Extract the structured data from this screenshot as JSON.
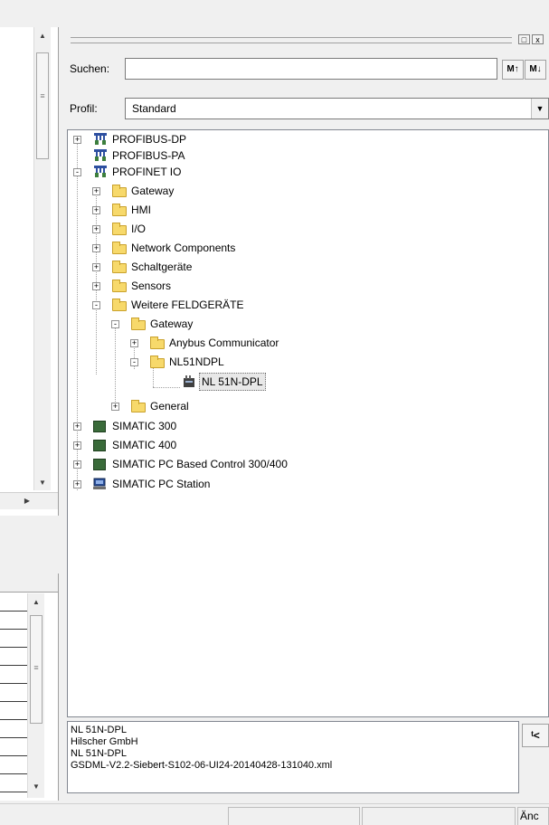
{
  "search": {
    "label": "Suchen:",
    "value": "",
    "find_up": "M↑",
    "find_down": "M↓"
  },
  "profile": {
    "label": "Profil:",
    "value": "Standard"
  },
  "panel_controls": {
    "float": "□",
    "close": "x"
  },
  "tree": [
    {
      "label": "PROFIBUS-DP",
      "icon": "network-bus-icon",
      "expander": "+"
    },
    {
      "label": "PROFIBUS-PA",
      "icon": "network-bus-icon",
      "expander": ""
    },
    {
      "label": "PROFINET IO",
      "icon": "network-bus-icon",
      "expander": "-"
    },
    {
      "label": "Gateway",
      "icon": "folder-icon",
      "expander": "+"
    },
    {
      "label": "HMI",
      "icon": "folder-icon",
      "expander": "+"
    },
    {
      "label": "I/O",
      "icon": "folder-icon",
      "expander": "+"
    },
    {
      "label": "Network Components",
      "icon": "folder-icon",
      "expander": "+"
    },
    {
      "label": "Schaltgeräte",
      "icon": "folder-icon",
      "expander": "+"
    },
    {
      "label": "Sensors",
      "icon": "folder-icon",
      "expander": "+"
    },
    {
      "label": "Weitere FELDGERÄTE",
      "icon": "folder-open-icon",
      "expander": "-"
    },
    {
      "label": "Gateway",
      "icon": "folder-open-icon",
      "expander": "-"
    },
    {
      "label": "Anybus Communicator",
      "icon": "folder-icon",
      "expander": "+"
    },
    {
      "label": "NL51NDPL",
      "icon": "folder-open-icon",
      "expander": "-"
    },
    {
      "label": "NL 51N-DPL",
      "icon": "device-icon",
      "expander": "",
      "selected": true
    },
    {
      "label": "General",
      "icon": "folder-icon",
      "expander": "+"
    },
    {
      "label": "SIMATIC 300",
      "icon": "simatic-rack-icon",
      "expander": "+"
    },
    {
      "label": "SIMATIC 400",
      "icon": "simatic-rack-icon",
      "expander": "+"
    },
    {
      "label": "SIMATIC PC Based Control 300/400",
      "icon": "simatic-rack-icon",
      "expander": "+"
    },
    {
      "label": "SIMATIC PC Station",
      "icon": "pc-station-icon",
      "expander": "+"
    }
  ],
  "info": {
    "line1": "NL 51N-DPL",
    "line2": "Hilscher GmbH",
    "line3": "NL 51N-DPL",
    "line4": "GSDML-V2.2-Siebert-S102-06-UI24-20140428-131040.xml"
  },
  "info_button": "ᵗ<",
  "statusbar": {
    "right_label": "Änc"
  },
  "colors": {
    "folder": "#f7d96b",
    "tree_bg": "#ffffff",
    "window_bg": "#f0f0f0"
  }
}
